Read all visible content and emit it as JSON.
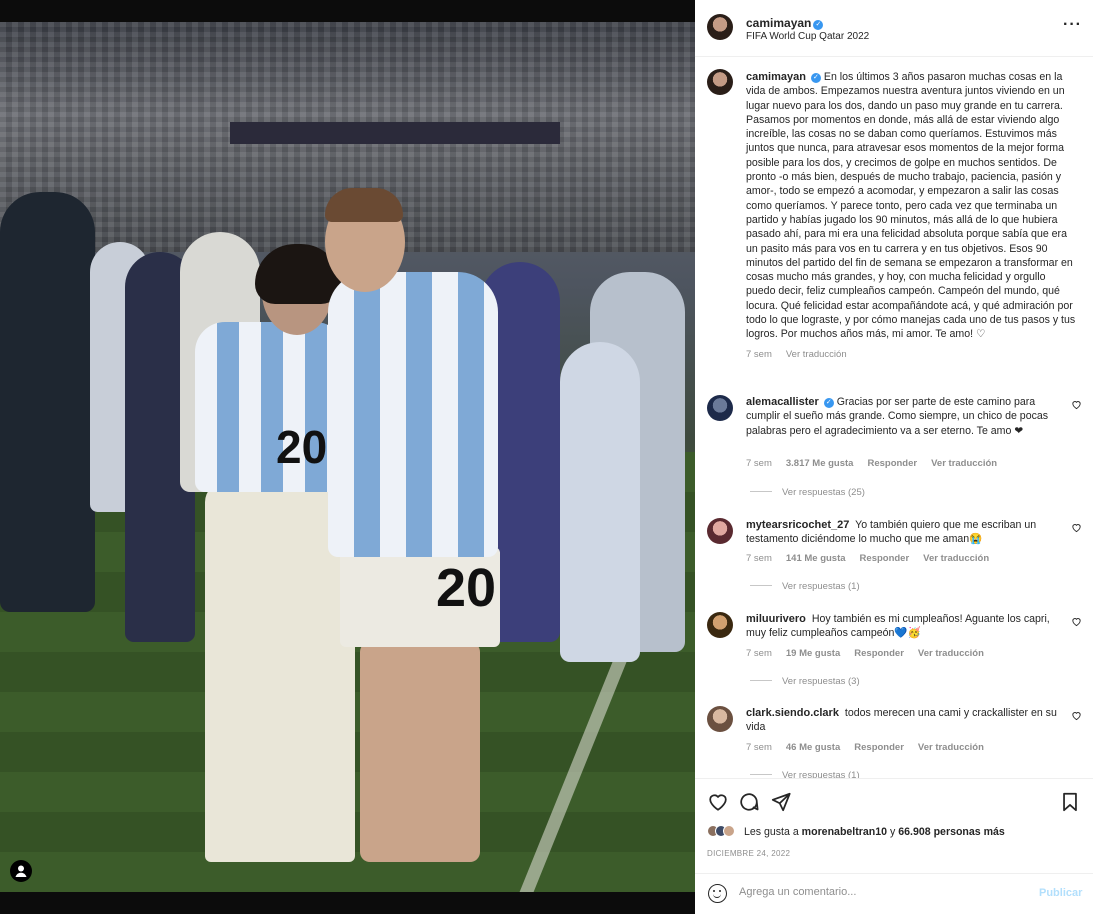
{
  "post": {
    "username": "camimayan",
    "location": "FIFA World Cup Qatar 2022"
  },
  "caption": {
    "username": "camimayan",
    "text": "En los últimos 3 años pasaron muchas cosas en la vida de ambos. Empezamos nuestra aventura juntos viviendo en un lugar nuevo para los dos, dando un paso muy grande en tu carrera. Pasamos por momentos en donde, más allá de estar viviendo algo increíble, las cosas no se daban como queríamos. Estuvimos más juntos que nunca, para atravesar esos momentos de la mejor forma posible para los dos, y crecimos de golpe en muchos sentidos. De pronto -o más bien, después de mucho trabajo, paciencia, pasión y amor-, todo se empezó a acomodar, y empezaron a salir las cosas como queríamos. Y parece tonto, pero cada vez que terminaba un partido y habías jugado los 90 minutos, más allá de lo que hubiera pasado ahí, para mi era una felicidad absoluta porque sabía que era un pasito más para vos en tu carrera y en tus objetivos. Esos 90 minutos del partido del fin de semana se empezaron a transformar en cosas mucho más grandes, y hoy, con mucha felicidad y orgullo puedo decir, feliz cumpleaños campeón. Campeón del mundo, qué locura. Qué felicidad estar acompañándote acá, y qué admiración por todo lo que lograste, y por cómo manejas cada uno de tus pasos y tus logros. Por muchos años más, mi amor. Te amo! ♡",
    "age": "7 sem",
    "translate": "Ver traducción"
  },
  "comments": [
    {
      "username": "alemacallister",
      "verified": true,
      "text": "Gracias por ser parte de este camino para cumplir el sueño más grande. Como siempre, un chico de pocas palabras pero el agradecimiento va a ser eterno. Te amo ❤",
      "age": "7 sem",
      "likes": "3.817 Me gusta",
      "reply": "Responder",
      "translate": "Ver traducción",
      "replies": "Ver respuestas (25)"
    },
    {
      "username": "mytearsricochet_27",
      "verified": false,
      "text": "Yo también quiero que me escriban un testamento diciéndome lo mucho que me aman😭",
      "age": "7 sem",
      "likes": "141 Me gusta",
      "reply": "Responder",
      "translate": "Ver traducción",
      "replies": "Ver respuestas (1)"
    },
    {
      "username": "miluurivero",
      "verified": false,
      "text": "Hoy también es mi cumpleaños! Aguante los capri, muy feliz cumpleaños campeón💙🥳",
      "age": "7 sem",
      "likes": "19 Me gusta",
      "reply": "Responder",
      "translate": "Ver traducción",
      "replies": "Ver respuestas (3)"
    },
    {
      "username": "clark.siendo.clark",
      "verified": false,
      "text": "todos merecen una cami y crackallister en su vida",
      "age": "7 sem",
      "likes": "46 Me gusta",
      "reply": "Responder",
      "translate": "Ver traducción",
      "replies": "Ver respuestas (1)"
    }
  ],
  "likes": {
    "prefix": "Les gusta a ",
    "user": "morenabeltran10",
    "middle": " y ",
    "count": "66.908 personas más"
  },
  "date": "DICIEMBRE 24, 2022",
  "add_comment": {
    "placeholder": "Agrega un comentario...",
    "publish": "Publicar"
  },
  "photo": {
    "number_woman": "20",
    "number_man": "20"
  },
  "colors": {
    "verified": "#3897f0",
    "heart": "#ed4956",
    "publish_disabled": "#b2dffc"
  },
  "icons": [
    "heart-icon",
    "comment-icon",
    "share-icon",
    "bookmark-icon",
    "more-icon",
    "emoji-icon",
    "user-tag-icon"
  ]
}
